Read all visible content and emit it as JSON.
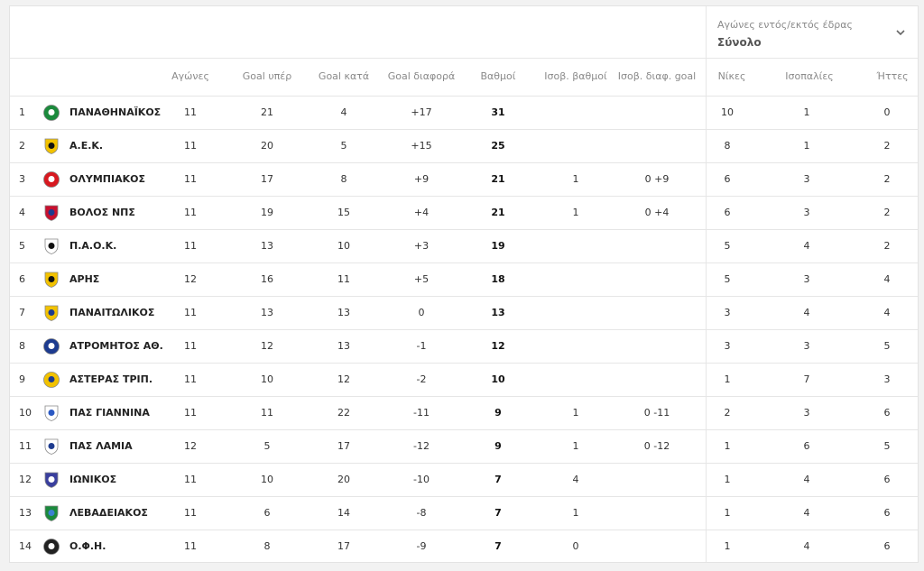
{
  "filter": {
    "label": "Αγώνες εντός/εκτός έδρας",
    "value": "Σύνολο"
  },
  "headers": {
    "played": "Αγώνες",
    "gf": "Goal υπέρ",
    "ga": "Goal κατά",
    "gd": "Goal διαφορά",
    "pts": "Βαθμοί",
    "h2h_pts": "Ισοβ. βαθμοί",
    "h2h_gd": "Ισοβ. διαφ. goal",
    "w": "Νίκες",
    "d": "Ισοπαλίες",
    "l": "Ήττες"
  },
  "rows": [
    {
      "pos": "1",
      "team": "ΠΑΝΑΘΗΝΑΪΚΟΣ",
      "logo": {
        "shape": "circle",
        "color": "#1b8a3c",
        "accent": "#ffffff"
      },
      "played": "11",
      "gf": "21",
      "ga": "4",
      "gd": "+17",
      "pts": "31",
      "h2h_pts": "",
      "h2h_gd": "",
      "w": "10",
      "d": "1",
      "l": "0"
    },
    {
      "pos": "2",
      "team": "Α.Ε.Κ.",
      "logo": {
        "shape": "shield",
        "color": "#f2c200",
        "accent": "#111111"
      },
      "played": "11",
      "gf": "20",
      "ga": "5",
      "gd": "+15",
      "pts": "25",
      "h2h_pts": "",
      "h2h_gd": "",
      "w": "8",
      "d": "1",
      "l": "2"
    },
    {
      "pos": "3",
      "team": "ΟΛΥΜΠΙΑΚΟΣ",
      "logo": {
        "shape": "circle",
        "color": "#d71920",
        "accent": "#ffffff"
      },
      "played": "11",
      "gf": "17",
      "ga": "8",
      "gd": "+9",
      "pts": "21",
      "h2h_pts": "1",
      "h2h_gd": "0 +9",
      "w": "6",
      "d": "3",
      "l": "2"
    },
    {
      "pos": "4",
      "team": "ΒΟΛΟΣ ΝΠΣ",
      "logo": {
        "shape": "shield",
        "color": "#c8102e",
        "accent": "#1d3b8f"
      },
      "played": "11",
      "gf": "19",
      "ga": "15",
      "gd": "+4",
      "pts": "21",
      "h2h_pts": "1",
      "h2h_gd": "0 +4",
      "w": "6",
      "d": "3",
      "l": "2"
    },
    {
      "pos": "5",
      "team": "Π.Α.Ο.Κ.",
      "logo": {
        "shape": "shield",
        "color": "#ffffff",
        "accent": "#111111"
      },
      "played": "11",
      "gf": "13",
      "ga": "10",
      "gd": "+3",
      "pts": "19",
      "h2h_pts": "",
      "h2h_gd": "",
      "w": "5",
      "d": "4",
      "l": "2"
    },
    {
      "pos": "6",
      "team": "ΑΡΗΣ",
      "logo": {
        "shape": "shield",
        "color": "#f2c200",
        "accent": "#111111"
      },
      "played": "12",
      "gf": "16",
      "ga": "11",
      "gd": "+5",
      "pts": "18",
      "h2h_pts": "",
      "h2h_gd": "",
      "w": "5",
      "d": "3",
      "l": "4"
    },
    {
      "pos": "7",
      "team": "ΠΑΝΑΙΤΩΛΙΚΟΣ",
      "logo": {
        "shape": "shield",
        "color": "#f2c200",
        "accent": "#1d3b8f"
      },
      "played": "11",
      "gf": "13",
      "ga": "13",
      "gd": "0",
      "pts": "13",
      "h2h_pts": "",
      "h2h_gd": "",
      "w": "3",
      "d": "4",
      "l": "4"
    },
    {
      "pos": "8",
      "team": "ΑΤΡΟΜΗΤΟΣ ΑΘ.",
      "logo": {
        "shape": "circle",
        "color": "#1d3b8f",
        "accent": "#ffffff"
      },
      "played": "11",
      "gf": "12",
      "ga": "13",
      "gd": "-1",
      "pts": "12",
      "h2h_pts": "",
      "h2h_gd": "",
      "w": "3",
      "d": "3",
      "l": "5"
    },
    {
      "pos": "9",
      "team": "ΑΣΤΕΡΑΣ ΤΡΙΠ.",
      "logo": {
        "shape": "circle",
        "color": "#f2c200",
        "accent": "#1d3b8f"
      },
      "played": "11",
      "gf": "10",
      "ga": "12",
      "gd": "-2",
      "pts": "10",
      "h2h_pts": "",
      "h2h_gd": "",
      "w": "1",
      "d": "7",
      "l": "3"
    },
    {
      "pos": "10",
      "team": "ΠΑΣ ΓΙΑΝΝΙΝΑ",
      "logo": {
        "shape": "shield",
        "color": "#ffffff",
        "accent": "#2b59c3"
      },
      "played": "11",
      "gf": "11",
      "ga": "22",
      "gd": "-11",
      "pts": "9",
      "h2h_pts": "1",
      "h2h_gd": "0 -11",
      "w": "2",
      "d": "3",
      "l": "6"
    },
    {
      "pos": "11",
      "team": "ΠΑΣ ΛΑΜΙΑ",
      "logo": {
        "shape": "shield",
        "color": "#ffffff",
        "accent": "#1d3b8f"
      },
      "played": "12",
      "gf": "5",
      "ga": "17",
      "gd": "-12",
      "pts": "9",
      "h2h_pts": "1",
      "h2h_gd": "0 -12",
      "w": "1",
      "d": "6",
      "l": "5"
    },
    {
      "pos": "12",
      "team": "ΙΩΝΙΚΟΣ",
      "logo": {
        "shape": "shield",
        "color": "#3a3f9e",
        "accent": "#ffffff"
      },
      "played": "11",
      "gf": "10",
      "ga": "20",
      "gd": "-10",
      "pts": "7",
      "h2h_pts": "4",
      "h2h_gd": "",
      "w": "1",
      "d": "4",
      "l": "6"
    },
    {
      "pos": "13",
      "team": "ΛΕΒΑΔΕΙΑΚΟΣ",
      "logo": {
        "shape": "shield",
        "color": "#1b8a3c",
        "accent": "#3d7fd1"
      },
      "played": "11",
      "gf": "6",
      "ga": "14",
      "gd": "-8",
      "pts": "7",
      "h2h_pts": "1",
      "h2h_gd": "",
      "w": "1",
      "d": "4",
      "l": "6"
    },
    {
      "pos": "14",
      "team": "Ο.Φ.Η.",
      "logo": {
        "shape": "circle",
        "color": "#222222",
        "accent": "#ffffff"
      },
      "played": "11",
      "gf": "8",
      "ga": "17",
      "gd": "-9",
      "pts": "7",
      "h2h_pts": "0",
      "h2h_gd": "",
      "w": "1",
      "d": "4",
      "l": "6"
    }
  ]
}
